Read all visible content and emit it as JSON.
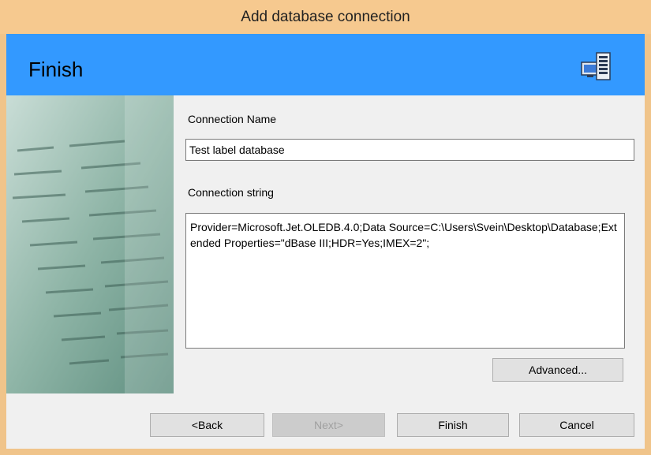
{
  "window": {
    "title": "Add database connection"
  },
  "banner": {
    "title": "Finish",
    "icon": "network-computers-icon",
    "background": "#3399ff"
  },
  "form": {
    "connection_name_label": "Connection Name",
    "connection_name_value": "Test label database",
    "connection_string_label": "Connection string",
    "connection_string_value": "Provider=Microsoft.Jet.OLEDB.4.0;Data Source=C:\\Users\\Svein\\Desktop\\Database;Extended Properties=\"dBase III;HDR=Yes;IMEX=2\";"
  },
  "buttons": {
    "advanced": "Advanced...",
    "back": "<Back",
    "next": "Next>",
    "finish": "Finish",
    "cancel": "Cancel"
  },
  "colors": {
    "titlebar": "#f6c98f",
    "frame": "#f0c48a",
    "client": "#f0f0f0"
  }
}
